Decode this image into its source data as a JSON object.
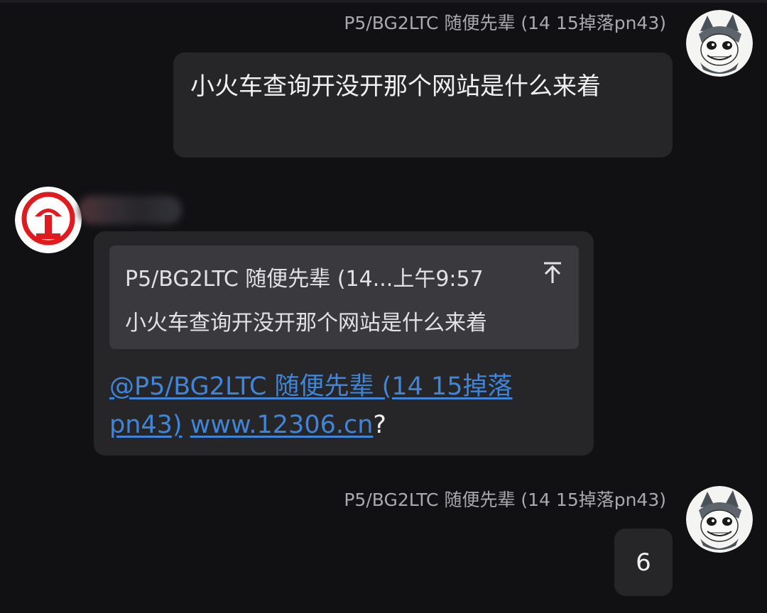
{
  "messages": [
    {
      "sender": "P5/BG2LTC 随便先辈 (14 15掉落pn43)",
      "text": "小火车查询开没开那个网站是什么来着"
    },
    {
      "sender": "",
      "quote": {
        "header": "P5/BG2LTC 随便先辈 (14...上午9:57",
        "text": "小火车查询开没开那个网站是什么来着"
      },
      "mention": "@P5/BG2LTC 随便先辈 (14 15掉落pn43)",
      "link": "www.12306.cn",
      "suffix": "?"
    },
    {
      "sender": "P5/BG2LTC 随便先辈 (14 15掉落pn43)",
      "text": "6"
    }
  ],
  "colors": {
    "background": "#111114",
    "bubble": "#262629",
    "quote_box": "#3a3a3e",
    "link": "#3f85d9",
    "sender_name": "#a9a9ae",
    "rail_logo_red": "#e01b20"
  },
  "icons": {
    "user_avatar": "anime-character-avatar",
    "railway_avatar": "china-railway-logo-icon",
    "quote_jump": "arrow-up-to-top-icon"
  }
}
